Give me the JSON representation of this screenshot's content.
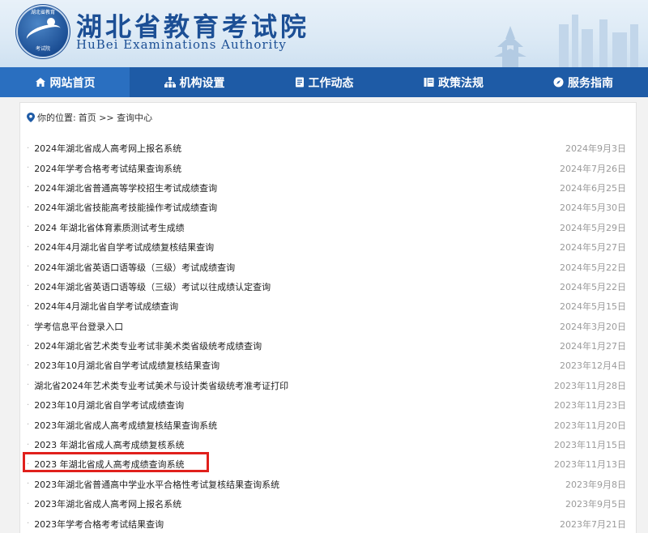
{
  "header": {
    "title": "湖北省教育考试院",
    "subtitle": "HuBei Examinations Authority",
    "seal_top": "湖北省教育",
    "seal_bottom": "考试院"
  },
  "nav": [
    {
      "label": "网站首页",
      "icon": "home-icon",
      "active": true
    },
    {
      "label": "机构设置",
      "icon": "org-chart-icon",
      "active": false
    },
    {
      "label": "工作动态",
      "icon": "document-icon",
      "active": false
    },
    {
      "label": "政策法规",
      "icon": "book-icon",
      "active": false
    },
    {
      "label": "服务指南",
      "icon": "compass-icon",
      "active": false
    }
  ],
  "breadcrumb": {
    "prefix": "你的位置:",
    "path": "首页 >> 查询中心"
  },
  "items": [
    {
      "title": "2024年湖北省成人高考网上报名系统",
      "date": "2024年9月3日"
    },
    {
      "title": "2024年学考合格考考试结果查询系统",
      "date": "2024年7月26日"
    },
    {
      "title": "2024年湖北省普通高等学校招生考试成绩查询",
      "date": "2024年6月25日"
    },
    {
      "title": "2024年湖北省技能高考技能操作考试成绩查询",
      "date": "2024年5月30日"
    },
    {
      "title": "2024 年湖北省体育素质测试考生成绩",
      "date": "2024年5月29日"
    },
    {
      "title": "2024年4月湖北省自学考试成绩复核结果查询",
      "date": "2024年5月27日"
    },
    {
      "title": "2024年湖北省英语口语等级（三级）考试成绩查询",
      "date": "2024年5月22日"
    },
    {
      "title": "2024年湖北省英语口语等级（三级）考试以往成绩认定查询",
      "date": "2024年5月22日"
    },
    {
      "title": "2024年4月湖北省自学考试成绩查询",
      "date": "2024年5月15日"
    },
    {
      "title": "学考信息平台登录入口",
      "date": "2024年3月20日"
    },
    {
      "title": "2024年湖北省艺术类专业考试非美术类省级统考成绩查询",
      "date": "2024年1月27日"
    },
    {
      "title": "2023年10月湖北省自学考试成绩复核结果查询",
      "date": "2023年12月4日"
    },
    {
      "title": "湖北省2024年艺术类专业考试美术与设计类省级统考准考证打印",
      "date": "2023年11月28日"
    },
    {
      "title": "2023年10月湖北省自学考试成绩查询",
      "date": "2023年11月23日"
    },
    {
      "title": "2023年湖北省成人高考成绩复核结果查询系统",
      "date": "2023年11月20日"
    },
    {
      "title": "2023 年湖北省成人高考成绩复核系统",
      "date": "2023年11月15日"
    },
    {
      "title": "2023 年湖北省成人高考成绩查询系统",
      "date": "2023年11月13日"
    },
    {
      "title": "2023年湖北省普通高中学业水平合格性考试复核结果查询系统",
      "date": "2023年9月8日"
    },
    {
      "title": "2023年湖北省成人高考网上报名系统",
      "date": "2023年9月5日"
    },
    {
      "title": "2023年学考合格考考试结果查询",
      "date": "2023年7月21日"
    }
  ],
  "colors": {
    "nav_bg": "#1e5ba6",
    "brand": "#1c4f95",
    "highlight": "#e0201c"
  }
}
